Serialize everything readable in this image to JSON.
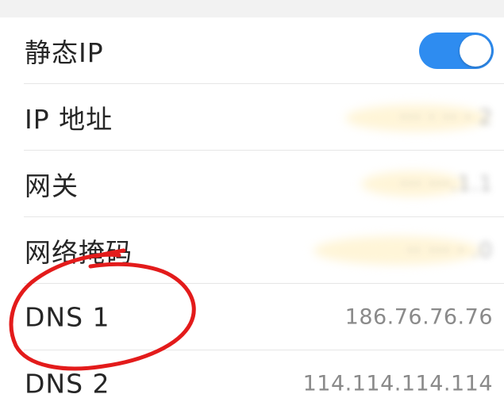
{
  "settings": {
    "static_ip": {
      "label": "静态IP",
      "enabled": true
    },
    "ip_address": {
      "label": "IP 地址",
      "value": "··· · ·· · 2"
    },
    "gateway": {
      "label": "网关",
      "value": "··· ···.1.1"
    },
    "subnet_mask": {
      "label": "网络掩码",
      "value": "·· ··· · .0"
    },
    "dns1": {
      "label": "DNS 1",
      "value": "186.76.76.76"
    },
    "dns2": {
      "label": "DNS 2",
      "value": "114.114.114.114"
    }
  },
  "colors": {
    "toggle_on": "#2e8cf0",
    "annotation": "#e31b1b"
  }
}
